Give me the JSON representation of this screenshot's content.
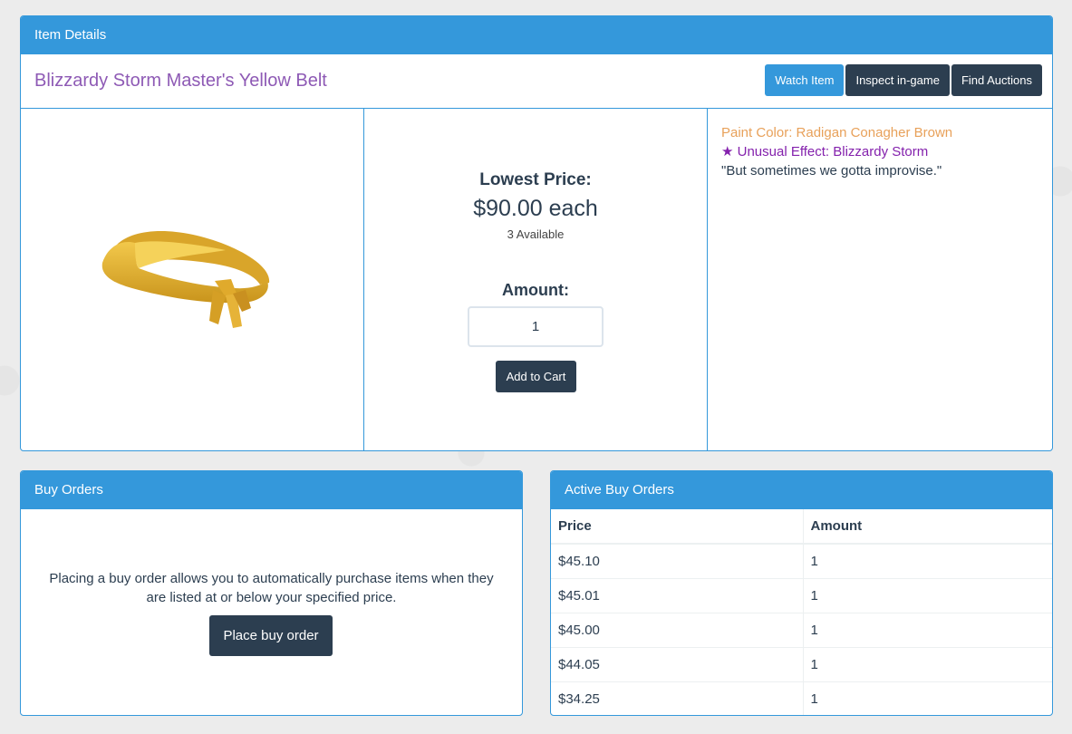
{
  "item_details": {
    "heading": "Item Details",
    "title": "Blizzardy Storm Master's Yellow Belt",
    "buttons": {
      "watch": "Watch Item",
      "inspect": "Inspect in-game",
      "auctions": "Find Auctions"
    },
    "price": {
      "label": "Lowest Price:",
      "value": "$90.00 each",
      "available": "3 Available"
    },
    "amount": {
      "label": "Amount:",
      "value": "1"
    },
    "add_to_cart": "Add to Cart",
    "description": {
      "paint": "Paint Color: Radigan Conagher Brown",
      "unusual": "★ Unusual Effect: Blizzardy Storm",
      "quote": "\"But sometimes we gotta improvise.\""
    },
    "colors": {
      "title": "#8e5ab5",
      "paint": "#e8a15a",
      "unusual": "#8421ad",
      "accent": "#3498db",
      "dark": "#2c3e50"
    }
  },
  "buy_orders": {
    "heading": "Buy Orders",
    "text": "Placing a buy order allows you to automatically purchase items when they are listed at or below your specified price.",
    "button": "Place buy order"
  },
  "active_orders": {
    "heading": "Active Buy Orders",
    "columns": [
      "Price",
      "Amount"
    ],
    "rows": [
      [
        "$45.10",
        "1"
      ],
      [
        "$45.01",
        "1"
      ],
      [
        "$45.00",
        "1"
      ],
      [
        "$44.05",
        "1"
      ],
      [
        "$34.25",
        "1"
      ]
    ]
  }
}
